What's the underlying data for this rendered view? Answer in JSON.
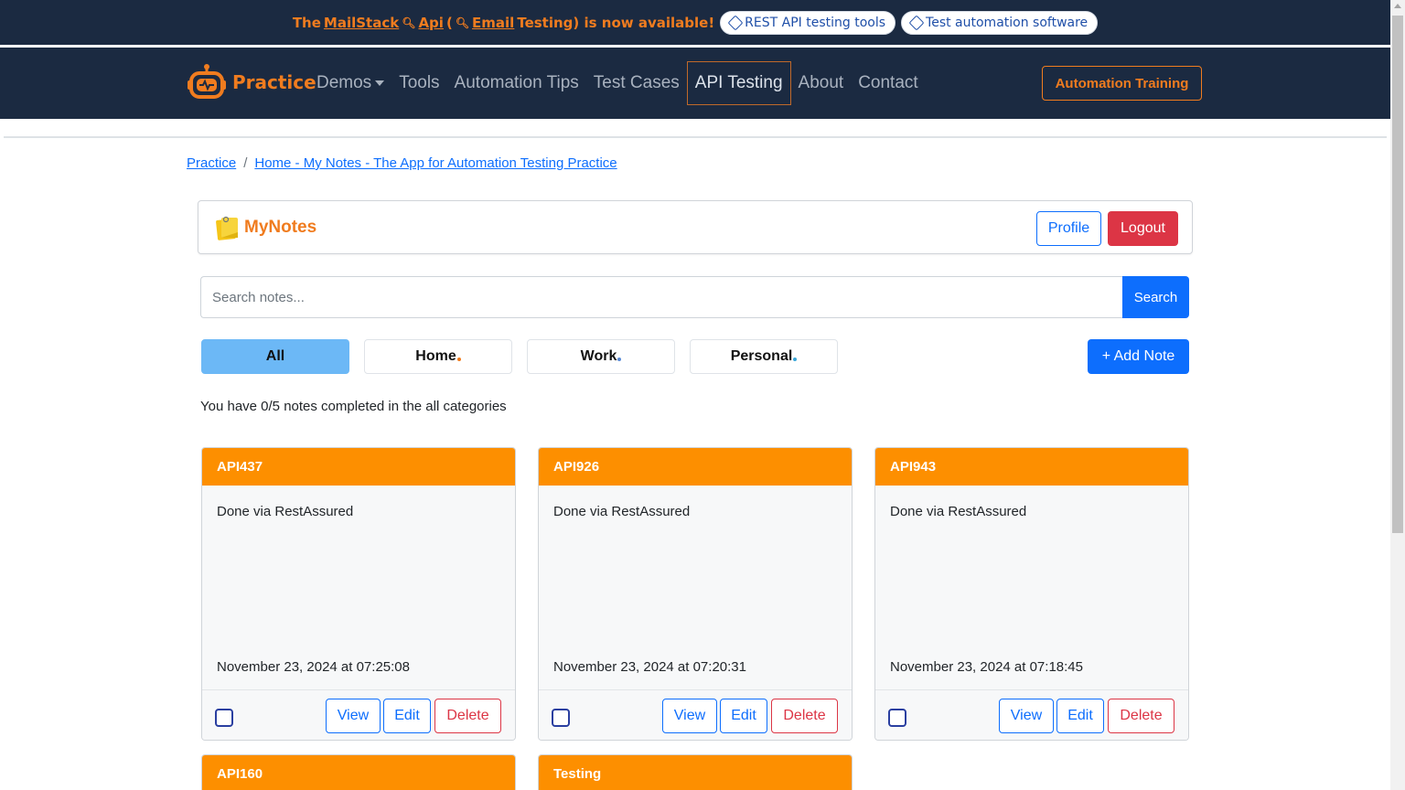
{
  "promo": {
    "prefix": "The",
    "mailstack": "MailStack",
    "api": "Api",
    "email_testing": "Email",
    "suffix": "Testing) is now available!",
    "paren_open": "(",
    "pills": [
      "REST API testing tools",
      "Test automation software"
    ]
  },
  "navbar": {
    "brand": "Practice",
    "links": [
      "Demos",
      "Tools",
      "Automation Tips",
      "Test Cases",
      "API Testing",
      "About",
      "Contact"
    ],
    "active": "API Testing",
    "training_button": "Automation Training",
    "brand_color": "#f07c1f"
  },
  "breadcrumb": {
    "items": [
      "Practice",
      "Home - My Notes - The App for Automation Testing Practice"
    ],
    "separator": "/"
  },
  "mynotes": {
    "title": "MyNotes",
    "profile_label": "Profile",
    "logout_label": "Logout"
  },
  "search": {
    "placeholder": "Search notes...",
    "button_label": "Search"
  },
  "categories": {
    "tabs": [
      {
        "label": "All",
        "dot_color": ""
      },
      {
        "label": "Home",
        "dot_color": "#f07c1f"
      },
      {
        "label": "Work",
        "dot_color": "#5a8bd6"
      },
      {
        "label": "Personal",
        "dot_color": "#3aa7d8"
      }
    ],
    "active": "All",
    "add_note_label": "+ Add Note"
  },
  "progress_text": "You have 0/5 notes completed in the all categories",
  "notes": [
    {
      "title": "API437",
      "description": "Done via RestAssured",
      "date": "November 23, 2024 at 07:25:08",
      "view": "View",
      "edit": "Edit",
      "delete": "Delete"
    },
    {
      "title": "API926",
      "description": "Done via RestAssured",
      "date": "November 23, 2024 at 07:20:31",
      "view": "View",
      "edit": "Edit",
      "delete": "Delete"
    },
    {
      "title": "API943",
      "description": "Done via RestAssured",
      "date": "November 23, 2024 at 07:18:45",
      "view": "View",
      "edit": "Edit",
      "delete": "Delete"
    },
    {
      "title": "API160"
    },
    {
      "title": "Testing"
    }
  ],
  "colors": {
    "navy": "#1b2a41",
    "orange_header": "#fd8f00",
    "primary": "#0d6efd",
    "danger": "#dc3545",
    "active_tab": "#6cb8f6"
  }
}
